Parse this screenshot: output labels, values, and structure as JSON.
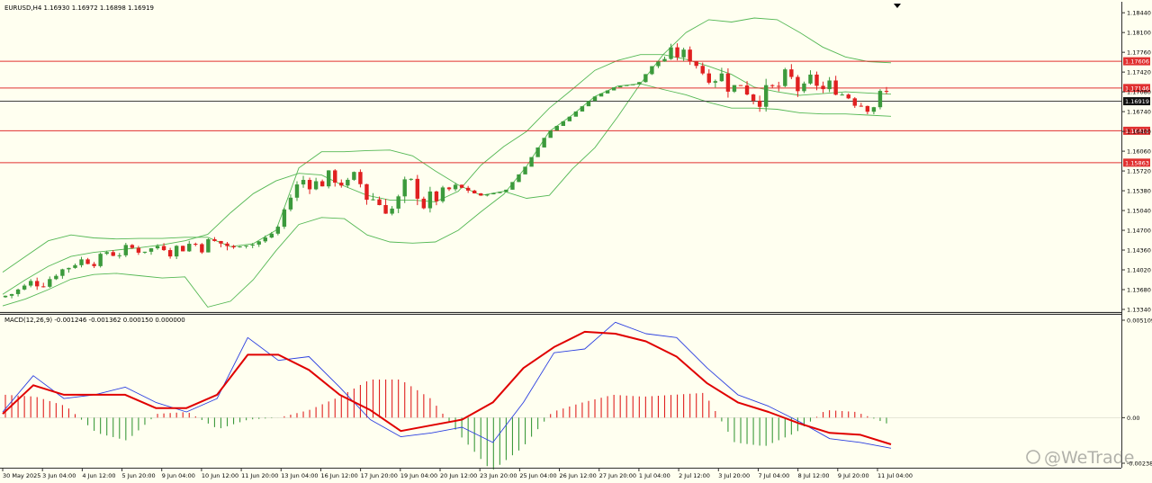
{
  "main_header": "EURUSD,H4  1.16930 1.16972 1.16898 1.16919",
  "macd_header": "MACD(12,26,9) -0.001246 -0.001362 0.000150 0.000000",
  "watermark": "@WeTrade",
  "colors": {
    "background": "#fffff0",
    "bull": "#3c9a3c",
    "bear": "#e02020",
    "band": "#55b855",
    "level_line": "#e03030",
    "price_line": "#404040",
    "macd_signal": "#e00000",
    "macd_line": "#2b3fe0"
  },
  "chart_data": [
    {
      "type": "candlestick",
      "symbol": "EURUSD",
      "timeframe": "H4",
      "ylim": [
        1.1334,
        1.1852
      ],
      "y_ticks": [
        "1.18440",
        "1.18100",
        "1.17760",
        "1.17420",
        "1.17080",
        "1.16740",
        "1.16400",
        "1.16060",
        "1.15720",
        "1.15380",
        "1.15040",
        "1.14700",
        "1.14360",
        "1.14020",
        "1.13680",
        "1.13340"
      ],
      "x_ticks": [
        "30 May 2025",
        "3 Jun 04:00",
        "4 Jun 12:00",
        "5 Jun 20:00",
        "9 Jun 04:00",
        "10 Jun 12:00",
        "11 Jun 20:00",
        "13 Jun 04:00",
        "16 Jun 12:00",
        "17 Jun 20:00",
        "19 Jun 04:00",
        "20 Jun 12:00",
        "23 Jun 20:00",
        "25 Jun 04:00",
        "26 Jun 12:00",
        "27 Jun 20:00",
        "1 Jul 04:00",
        "2 Jul 12:00",
        "3 Jul 20:00",
        "7 Jul 04:00",
        "8 Jul 12:00",
        "9 Jul 20:00",
        "11 Jul 04:00"
      ],
      "current_price": "1.16919",
      "horizontal_levels": [
        "1.17606",
        "1.17146",
        "1.16411",
        "1.15863"
      ],
      "bollinger_bands": {
        "upper": [
          1.1398,
          1.1425,
          1.1452,
          1.1462,
          1.1457,
          1.1455,
          1.1456,
          1.1456,
          1.1458,
          1.1458,
          1.1442,
          1.1447,
          1.147,
          1.1577,
          1.1605,
          1.1605,
          1.1607,
          1.1608,
          1.1598,
          1.1572,
          1.1548,
          1.153,
          1.1537,
          1.1525,
          1.153,
          1.1575,
          1.1612,
          1.1665,
          1.1722,
          1.1772,
          1.181,
          1.1832,
          1.1828,
          1.1835,
          1.1832,
          1.181,
          1.1785,
          1.1768,
          1.176,
          1.1758
        ],
        "middle": [
          1.136,
          1.1385,
          1.1408,
          1.1425,
          1.1432,
          1.1436,
          1.144,
          1.1445,
          1.1452,
          1.1463,
          1.15,
          1.1533,
          1.1555,
          1.1568,
          1.1565,
          1.1546,
          1.153,
          1.1522,
          1.1522,
          1.1519,
          1.1537,
          1.1582,
          1.1614,
          1.164,
          1.168,
          1.1712,
          1.1745,
          1.1762,
          1.1772,
          1.1772,
          1.1764,
          1.1752,
          1.1738,
          1.1716,
          1.1708,
          1.1702,
          1.1705,
          1.1708,
          1.1706,
          1.1704
        ],
        "lower": [
          1.134,
          1.1352,
          1.1368,
          1.1386,
          1.1394,
          1.1396,
          1.1392,
          1.1388,
          1.139,
          1.1338,
          1.1348,
          1.1385,
          1.1435,
          1.148,
          1.1492,
          1.149,
          1.1462,
          1.145,
          1.1448,
          1.145,
          1.147,
          1.1502,
          1.1532,
          1.158,
          1.164,
          1.1668,
          1.17,
          1.1718,
          1.1722,
          1.1712,
          1.1703,
          1.169,
          1.168,
          1.168,
          1.1678,
          1.1672,
          1.167,
          1.167,
          1.1668,
          1.1666
        ]
      }
    },
    {
      "type": "macd",
      "params": "12,26,9",
      "ylim": [
        -0.002388,
        0.005109
      ],
      "y_ticks": [
        "0.005109",
        "0.00",
        "-0.002388"
      ],
      "macd_line": [
        0.0003,
        0.0022,
        0.001,
        0.0012,
        0.0016,
        0.0008,
        0.0003,
        0.001,
        0.0042,
        0.003,
        0.0032,
        0.0016,
        -0.0001,
        -0.001,
        -0.0008,
        -0.0005,
        -0.0013,
        0.0008,
        0.0034,
        0.0036,
        0.005,
        0.0044,
        0.0042,
        0.0026,
        0.0012,
        0.0006,
        -0.0002,
        -0.0011,
        -0.0013,
        -0.0016
      ],
      "signal_line": [
        0.0002,
        0.0017,
        0.0012,
        0.0012,
        0.0012,
        0.0005,
        0.0005,
        0.0012,
        0.0033,
        0.0033,
        0.0025,
        0.0012,
        0.0004,
        -0.0007,
        -0.0004,
        -0.0001,
        0.0008,
        0.0026,
        0.0037,
        0.0045,
        0.0044,
        0.004,
        0.0032,
        0.0018,
        0.0008,
        0.0003,
        -0.0003,
        -0.0008,
        -0.0009,
        -0.0014
      ],
      "histogram": [
        0.0012,
        0.0011,
        0.0006,
        -0.0008,
        -0.0012,
        0.0002,
        0.0003,
        -0.0006,
        -0.0001,
        0.0,
        0.0004,
        0.0011,
        0.002,
        0.002,
        0.001,
        -0.001,
        -0.0028,
        -0.0016,
        0.0003,
        0.0008,
        0.0012,
        0.0011,
        0.0012,
        0.0013,
        -0.0013,
        -0.0015,
        -0.0008,
        0.0004,
        0.0003,
        -0.0003
      ]
    }
  ]
}
